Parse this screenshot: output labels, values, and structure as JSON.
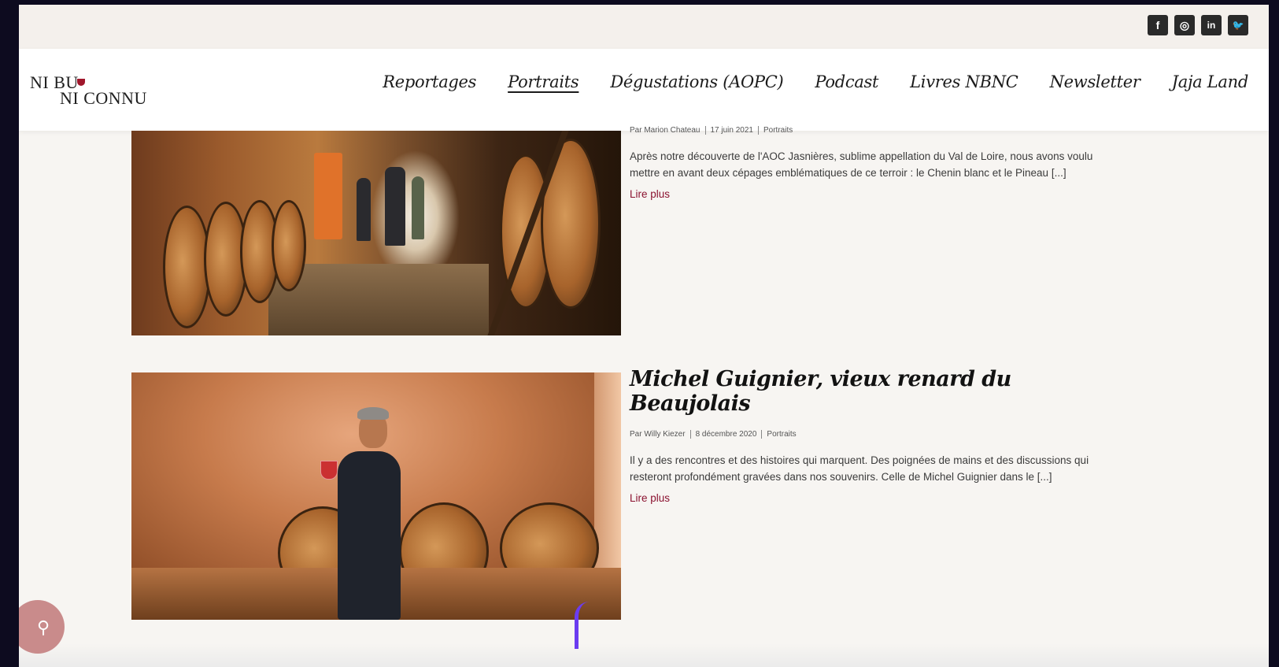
{
  "social": [
    {
      "name": "facebook",
      "glyph": "f"
    },
    {
      "name": "instagram",
      "glyph": "◎"
    },
    {
      "name": "linkedin",
      "glyph": "in"
    },
    {
      "name": "twitter",
      "glyph": "🐦"
    }
  ],
  "logo": {
    "line1": "NI BU",
    "line2": "NI CONNU"
  },
  "nav": [
    {
      "label": "Reportages",
      "active": false
    },
    {
      "label": "Portraits",
      "active": true
    },
    {
      "label": "Dégustations (AOPC)",
      "active": false
    },
    {
      "label": "Podcast",
      "active": false
    },
    {
      "label": "Livres NBNC",
      "active": false
    },
    {
      "label": "Newsletter",
      "active": false
    },
    {
      "label": "Jaja Land",
      "active": false
    }
  ],
  "articles": [
    {
      "author": "Par Marion Chateau",
      "date": "17 juin 2021",
      "category": "Portraits",
      "excerpt": "Après notre découverte de l'AOC Jasnières, sublime appellation du Val de Loire, nous avons voulu mettre en avant deux cépages emblématiques de ce terroir : le Chenin blanc et le Pineau [...]",
      "read_more": "Lire plus"
    },
    {
      "title": "Michel Guignier, vieux renard du Beaujolais",
      "author": "Par Willy Kiezer",
      "date": "8 décembre 2020",
      "category": "Portraits",
      "excerpt": "Il y a des rencontres et des histoires qui marquent. Des poignées de mains et des discussions qui resteront profondément gravées dans nos souvenirs. Celle de Michel Guignier dans le [...]",
      "read_more": "Lire plus"
    }
  ],
  "search_fab": {
    "icon": "search-icon",
    "glyph": "⚲"
  },
  "colors": {
    "accent": "#8b1230",
    "background": "#f7f5f2",
    "topbar": "#f4f0ec",
    "search_fab": "#c98b8b"
  }
}
